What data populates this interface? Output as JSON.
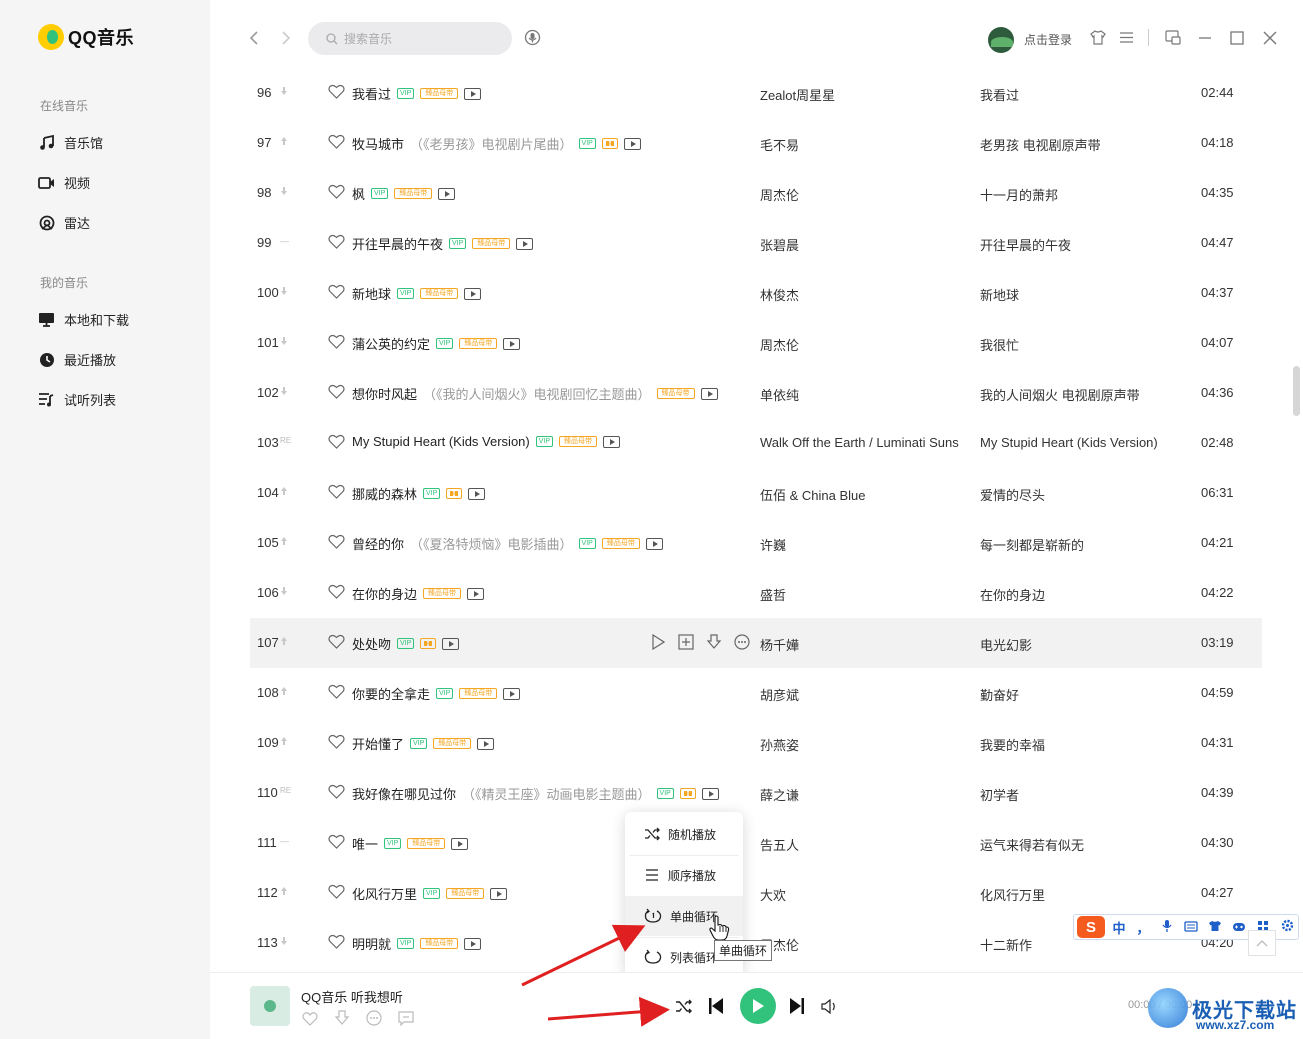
{
  "app": {
    "name": "QQ音乐"
  },
  "sidebar": {
    "sections": [
      {
        "title": "在线音乐",
        "items": [
          {
            "label": "音乐馆",
            "icon": "music-note-icon"
          },
          {
            "label": "视频",
            "icon": "video-icon"
          },
          {
            "label": "雷达",
            "icon": "radar-icon"
          }
        ]
      },
      {
        "title": "我的音乐",
        "items": [
          {
            "label": "本地和下载",
            "icon": "monitor-icon"
          },
          {
            "label": "最近播放",
            "icon": "clock-icon"
          },
          {
            "label": "试听列表",
            "icon": "playlist-icon"
          }
        ]
      }
    ]
  },
  "topbar": {
    "search_placeholder": "搜索音乐",
    "login_label": "点击登录"
  },
  "songs": [
    {
      "num": "96",
      "trend": "down",
      "title": "我看过",
      "subtitle": "",
      "badges": [
        "vip",
        "quality",
        "mv"
      ],
      "artist": "Zealot周星星",
      "album": "我看过",
      "duration": "02:44"
    },
    {
      "num": "97",
      "trend": "up",
      "title": "牧马城市",
      "subtitle": "（《老男孩》电视剧片尾曲）",
      "badges": [
        "vip",
        "dolby",
        "mv"
      ],
      "artist": "毛不易",
      "album": "老男孩 电视剧原声带",
      "duration": "04:18"
    },
    {
      "num": "98",
      "trend": "down",
      "title": "枫",
      "subtitle": "",
      "badges": [
        "vip",
        "quality",
        "mv"
      ],
      "artist": "周杰伦",
      "album": "十一月的萧邦",
      "duration": "04:35"
    },
    {
      "num": "99",
      "trend": "same",
      "title": "开往早晨的午夜",
      "subtitle": "",
      "badges": [
        "vip",
        "quality",
        "mv"
      ],
      "artist": "张碧晨",
      "album": "开往早晨的午夜",
      "duration": "04:47"
    },
    {
      "num": "100",
      "trend": "down",
      "title": "新地球",
      "subtitle": "",
      "badges": [
        "vip",
        "quality",
        "mv"
      ],
      "artist": "林俊杰",
      "album": "新地球",
      "duration": "04:37"
    },
    {
      "num": "101",
      "trend": "down",
      "title": "蒲公英的约定",
      "subtitle": "",
      "badges": [
        "vip",
        "quality",
        "mv"
      ],
      "artist": "周杰伦",
      "album": "我很忙",
      "duration": "04:07"
    },
    {
      "num": "102",
      "trend": "down",
      "title": "想你时风起",
      "subtitle": "（《我的人间烟火》电视剧回忆主题曲）",
      "badges": [
        "quality",
        "mv"
      ],
      "artist": "单依纯",
      "album": "我的人间烟火 电视剧原声带",
      "duration": "04:36"
    },
    {
      "num": "103",
      "trend": "RE",
      "title": "My Stupid Heart (Kids Version)",
      "subtitle": "",
      "badges": [
        "vip",
        "quality",
        "mv"
      ],
      "artist": "Walk Off the Earth / Luminati Suns",
      "album": "My Stupid Heart (Kids Version)",
      "duration": "02:48"
    },
    {
      "num": "104",
      "trend": "up",
      "title": "挪威的森林",
      "subtitle": "",
      "badges": [
        "vip",
        "dolby",
        "mv"
      ],
      "artist": "伍佰 & China Blue",
      "album": "爱情的尽头",
      "duration": "06:31"
    },
    {
      "num": "105",
      "trend": "up",
      "title": "曾经的你",
      "subtitle": "（《夏洛特烦恼》电影插曲）",
      "badges": [
        "vip",
        "quality",
        "mv"
      ],
      "artist": "许巍",
      "album": "每一刻都是崭新的",
      "duration": "04:21"
    },
    {
      "num": "106",
      "trend": "down",
      "title": "在你的身边",
      "subtitle": "",
      "badges": [
        "quality",
        "mv"
      ],
      "artist": "盛哲",
      "album": "在你的身边",
      "duration": "04:22"
    },
    {
      "num": "107",
      "trend": "up",
      "title": "处处吻",
      "subtitle": "",
      "badges": [
        "vip",
        "dolby",
        "mv"
      ],
      "artist": "杨千嬅",
      "album": "电光幻影",
      "duration": "03:19"
    },
    {
      "num": "108",
      "trend": "up",
      "title": "你要的全拿走",
      "subtitle": "",
      "badges": [
        "vip",
        "quality",
        "mv"
      ],
      "artist": "胡彦斌",
      "album": "勤奋好",
      "duration": "04:59"
    },
    {
      "num": "109",
      "trend": "up",
      "title": "开始懂了",
      "subtitle": "",
      "badges": [
        "vip",
        "quality",
        "mv"
      ],
      "artist": "孙燕姿",
      "album": "我要的幸福",
      "duration": "04:31"
    },
    {
      "num": "110",
      "trend": "RE",
      "title": "我好像在哪见过你",
      "subtitle": "（《精灵王座》动画电影主题曲）",
      "badges": [
        "vip",
        "dolby",
        "mv"
      ],
      "artist": "薛之谦",
      "album": "初学者",
      "duration": "04:39"
    },
    {
      "num": "111",
      "trend": "same",
      "title": "唯一",
      "subtitle": "",
      "badges": [
        "vip",
        "quality",
        "mv"
      ],
      "artist": "告五人",
      "album": "运气来得若有似无",
      "duration": "04:30"
    },
    {
      "num": "112",
      "trend": "up",
      "title": "化风行万里",
      "subtitle": "",
      "badges": [
        "vip",
        "quality",
        "mv"
      ],
      "artist": "大欢",
      "album": "化风行万里",
      "duration": "04:27"
    },
    {
      "num": "113",
      "trend": "down",
      "title": "明明就",
      "subtitle": "",
      "badges": [
        "vip",
        "quality",
        "mv"
      ],
      "artist": "周杰伦",
      "album": "十二新作",
      "duration": "04:20"
    }
  ],
  "badge_text": {
    "vip": "VIP",
    "quality": "臻品母带",
    "dolby": ""
  },
  "hovered_row": 11,
  "play_modes": [
    {
      "label": "随机播放",
      "icon": "shuffle-icon"
    },
    {
      "label": "顺序播放",
      "icon": "list-order-icon"
    },
    {
      "label": "单曲循环",
      "icon": "repeat-one-icon"
    },
    {
      "label": "列表循环",
      "icon": "repeat-icon"
    }
  ],
  "active_mode": 2,
  "tooltip": "单曲循环",
  "player": {
    "now_playing": "QQ音乐 听我想听",
    "time": "00:00 / 00:00"
  },
  "ime": {
    "items": [
      "中",
      "，"
    ]
  },
  "watermark": {
    "text": "极光下载站",
    "url": "www.xz7.com"
  },
  "colors": {
    "accent": "#31c27c",
    "arrow": "#e02020",
    "quality": "#f5a623"
  }
}
